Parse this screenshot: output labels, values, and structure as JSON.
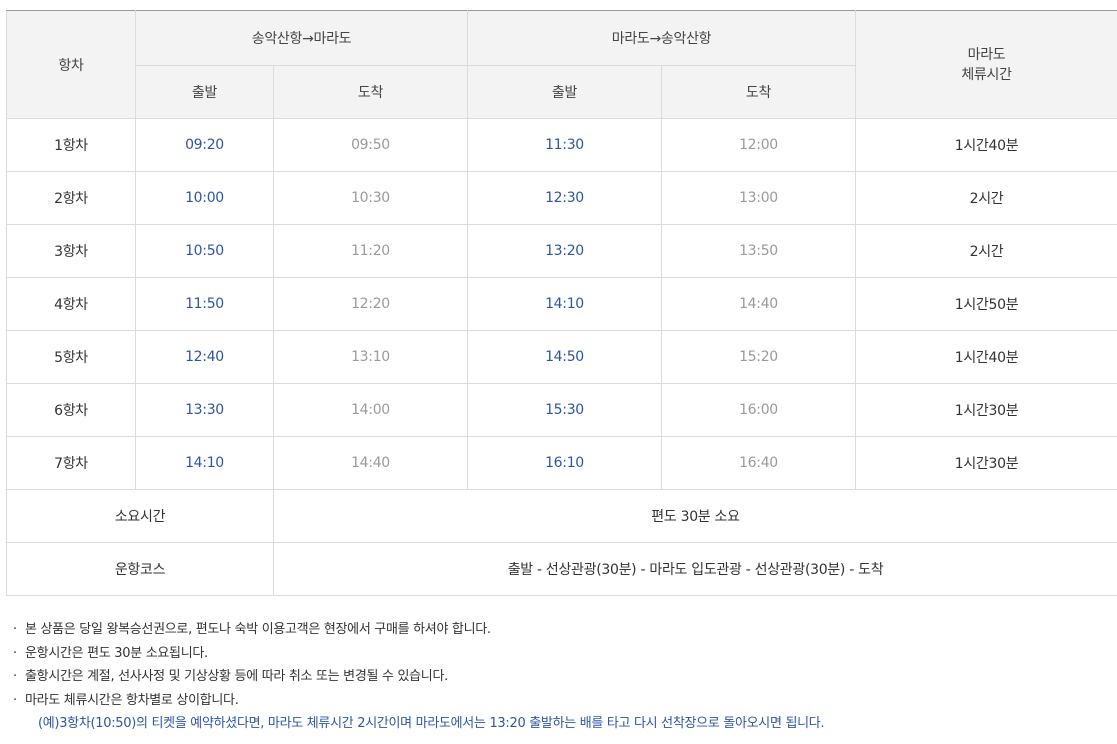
{
  "header": {
    "voyage": "항차",
    "route_out": "송악산항→마라도",
    "route_back": "마라도→송악산항",
    "stay_line1": "마라도",
    "stay_line2": "체류시간",
    "depart": "출발",
    "arrive": "도착"
  },
  "rows": [
    {
      "voyage": "1항차",
      "out_dep": "09:20",
      "out_arr": "09:50",
      "back_dep": "11:30",
      "back_arr": "12:00",
      "stay": "1시간40분"
    },
    {
      "voyage": "2항차",
      "out_dep": "10:00",
      "out_arr": "10:30",
      "back_dep": "12:30",
      "back_arr": "13:00",
      "stay": "2시간"
    },
    {
      "voyage": "3항차",
      "out_dep": "10:50",
      "out_arr": "11:20",
      "back_dep": "13:20",
      "back_arr": "13:50",
      "stay": "2시간"
    },
    {
      "voyage": "4항차",
      "out_dep": "11:50",
      "out_arr": "12:20",
      "back_dep": "14:10",
      "back_arr": "14:40",
      "stay": "1시간50분"
    },
    {
      "voyage": "5항차",
      "out_dep": "12:40",
      "out_arr": "13:10",
      "back_dep": "14:50",
      "back_arr": "15:20",
      "stay": "1시간40분"
    },
    {
      "voyage": "6항차",
      "out_dep": "13:30",
      "out_arr": "14:00",
      "back_dep": "15:30",
      "back_arr": "16:00",
      "stay": "1시간30분"
    },
    {
      "voyage": "7항차",
      "out_dep": "14:10",
      "out_arr": "14:40",
      "back_dep": "16:10",
      "back_arr": "16:40",
      "stay": "1시간30분"
    }
  ],
  "duration": {
    "label": "소요시간",
    "value": "편도 30분 소요"
  },
  "course": {
    "label": "운항코스",
    "value": "출발 - 선상관광(30분) - 마라도 입도관광 - 선상관광(30분) - 도착"
  },
  "notes": {
    "bullet": "·",
    "items": [
      "본 상품은 당일 왕복승선권으로, 편도나 숙박 이용고객은 현장에서 구매를 하셔야 합니다.",
      "운항시간은 편도 30분 소요됩니다.",
      "출항시간은 계절, 선사사정 및 기상상황 등에 따라 취소 또는 변경될 수 있습니다.",
      "마라도 체류시간은 항차별로 상이합니다."
    ],
    "example": "(예)3항차(10:50)의 티켓을 예약하셨다면, 마라도 체류시간 2시간이며 마라도에서는 13:20 출발하는 배를 타고 다시 선착장으로 돌아오시면 됩니다."
  },
  "colors": {
    "departure_time": "#2c55a8",
    "arrival_time": "#9a9a9a",
    "header_background": "#f3f3f3",
    "border": "#dcdcdc",
    "example_text": "#2c55a8"
  }
}
